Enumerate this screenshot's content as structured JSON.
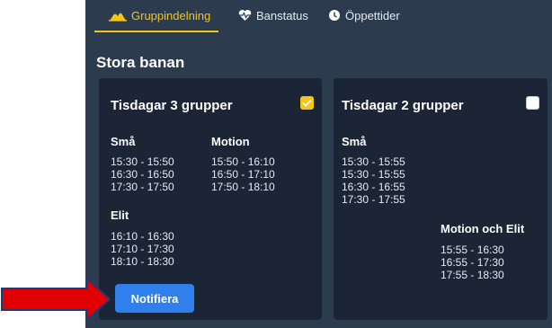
{
  "tabs": [
    {
      "label": "Gruppindelning",
      "icon": "mountain-icon",
      "active": true
    },
    {
      "label": "Banstatus",
      "icon": "heart-pulse-icon",
      "active": false
    },
    {
      "label": "Öppettider",
      "icon": "clock-icon",
      "active": false
    }
  ],
  "section_title": "Stora banan",
  "cards": [
    {
      "title": "Tisdagar 3 grupper",
      "checked": true,
      "groups": [
        {
          "label": "Små",
          "times": [
            "15:30 - 15:50",
            "16:30 - 16:50",
            "17:30 - 17:50"
          ]
        },
        {
          "label": "Motion",
          "times": [
            "15:50 - 16:10",
            "16:50 - 17:10",
            "17:50 - 18:10"
          ]
        },
        {
          "label": "Elit",
          "times": [
            "16:10 - 16:30",
            "17:10 - 17:30",
            "18:10 - 18:30"
          ]
        }
      ],
      "button_label": "Notifiera"
    },
    {
      "title": "Tisdagar 2 grupper",
      "checked": false,
      "groups": [
        {
          "label": "Små",
          "times": [
            "15:30 - 15:55",
            "15:30 - 15:55",
            "16:30 - 16:55",
            "17:30 - 17:55"
          ]
        },
        {
          "label": "Motion och Elit",
          "times": [
            "15:55 - 16:30",
            "16:55 - 17:30",
            "17:55 - 18:30"
          ]
        }
      ]
    }
  ],
  "colors": {
    "background": "#2d3b4f",
    "card": "#1c2535",
    "accent": "#f5c518",
    "button": "#2f80ed",
    "arrow": "#e00000"
  }
}
